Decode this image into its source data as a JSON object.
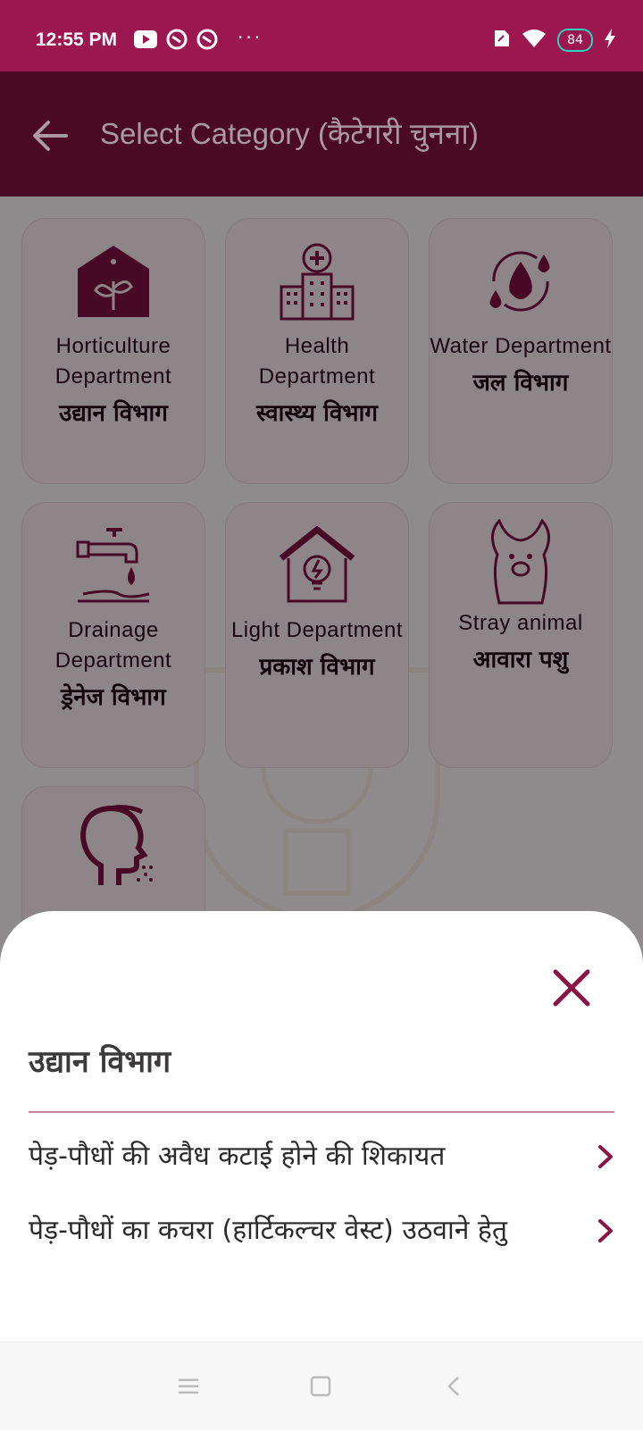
{
  "status_bar": {
    "time": "12:55 PM",
    "battery": "84",
    "left_icons": [
      "youtube-icon",
      "notification-icon",
      "notification-icon"
    ],
    "more": "···",
    "right_icons": [
      "sim-icon",
      "wifi-icon",
      "battery-icon",
      "charging-icon"
    ]
  },
  "app_bar": {
    "title": "Select Category (कैटेगरी चुनना)",
    "back_icon": "arrow-left-icon"
  },
  "categories": [
    {
      "en": "Horticulture Department",
      "hi": "उद्यान विभाग",
      "icon": "greenhouse-icon"
    },
    {
      "en": "Health Department",
      "hi": "स्वास्थ्य विभाग",
      "icon": "hospital-icon"
    },
    {
      "en": "Water Department",
      "hi": "जल विभाग",
      "icon": "water-drops-icon"
    },
    {
      "en": "Drainage Department",
      "hi": "ड्रेनेज विभाग",
      "icon": "tap-icon"
    },
    {
      "en": "Light Department",
      "hi": "प्रकाश विभाग",
      "icon": "light-house-icon"
    },
    {
      "en": "Stray animal",
      "hi": "आवारा पशु",
      "icon": "llama-icon"
    },
    {
      "en": "",
      "hi": "",
      "icon": "person-cough-icon"
    }
  ],
  "sheet": {
    "title": "उद्यान विभाग",
    "options": [
      "पेड़-पौधों की अवैध कटाई होने की शिकायत",
      "पेड़-पौधों का कचरा (हार्टिकल्चर वेस्ट) उठवाने हेतु"
    ]
  },
  "colors": {
    "status_bar": "#9c1650",
    "app_bar": "#4b0a24",
    "accent": "#8a1346",
    "card_bg": "#f4e6ec"
  }
}
